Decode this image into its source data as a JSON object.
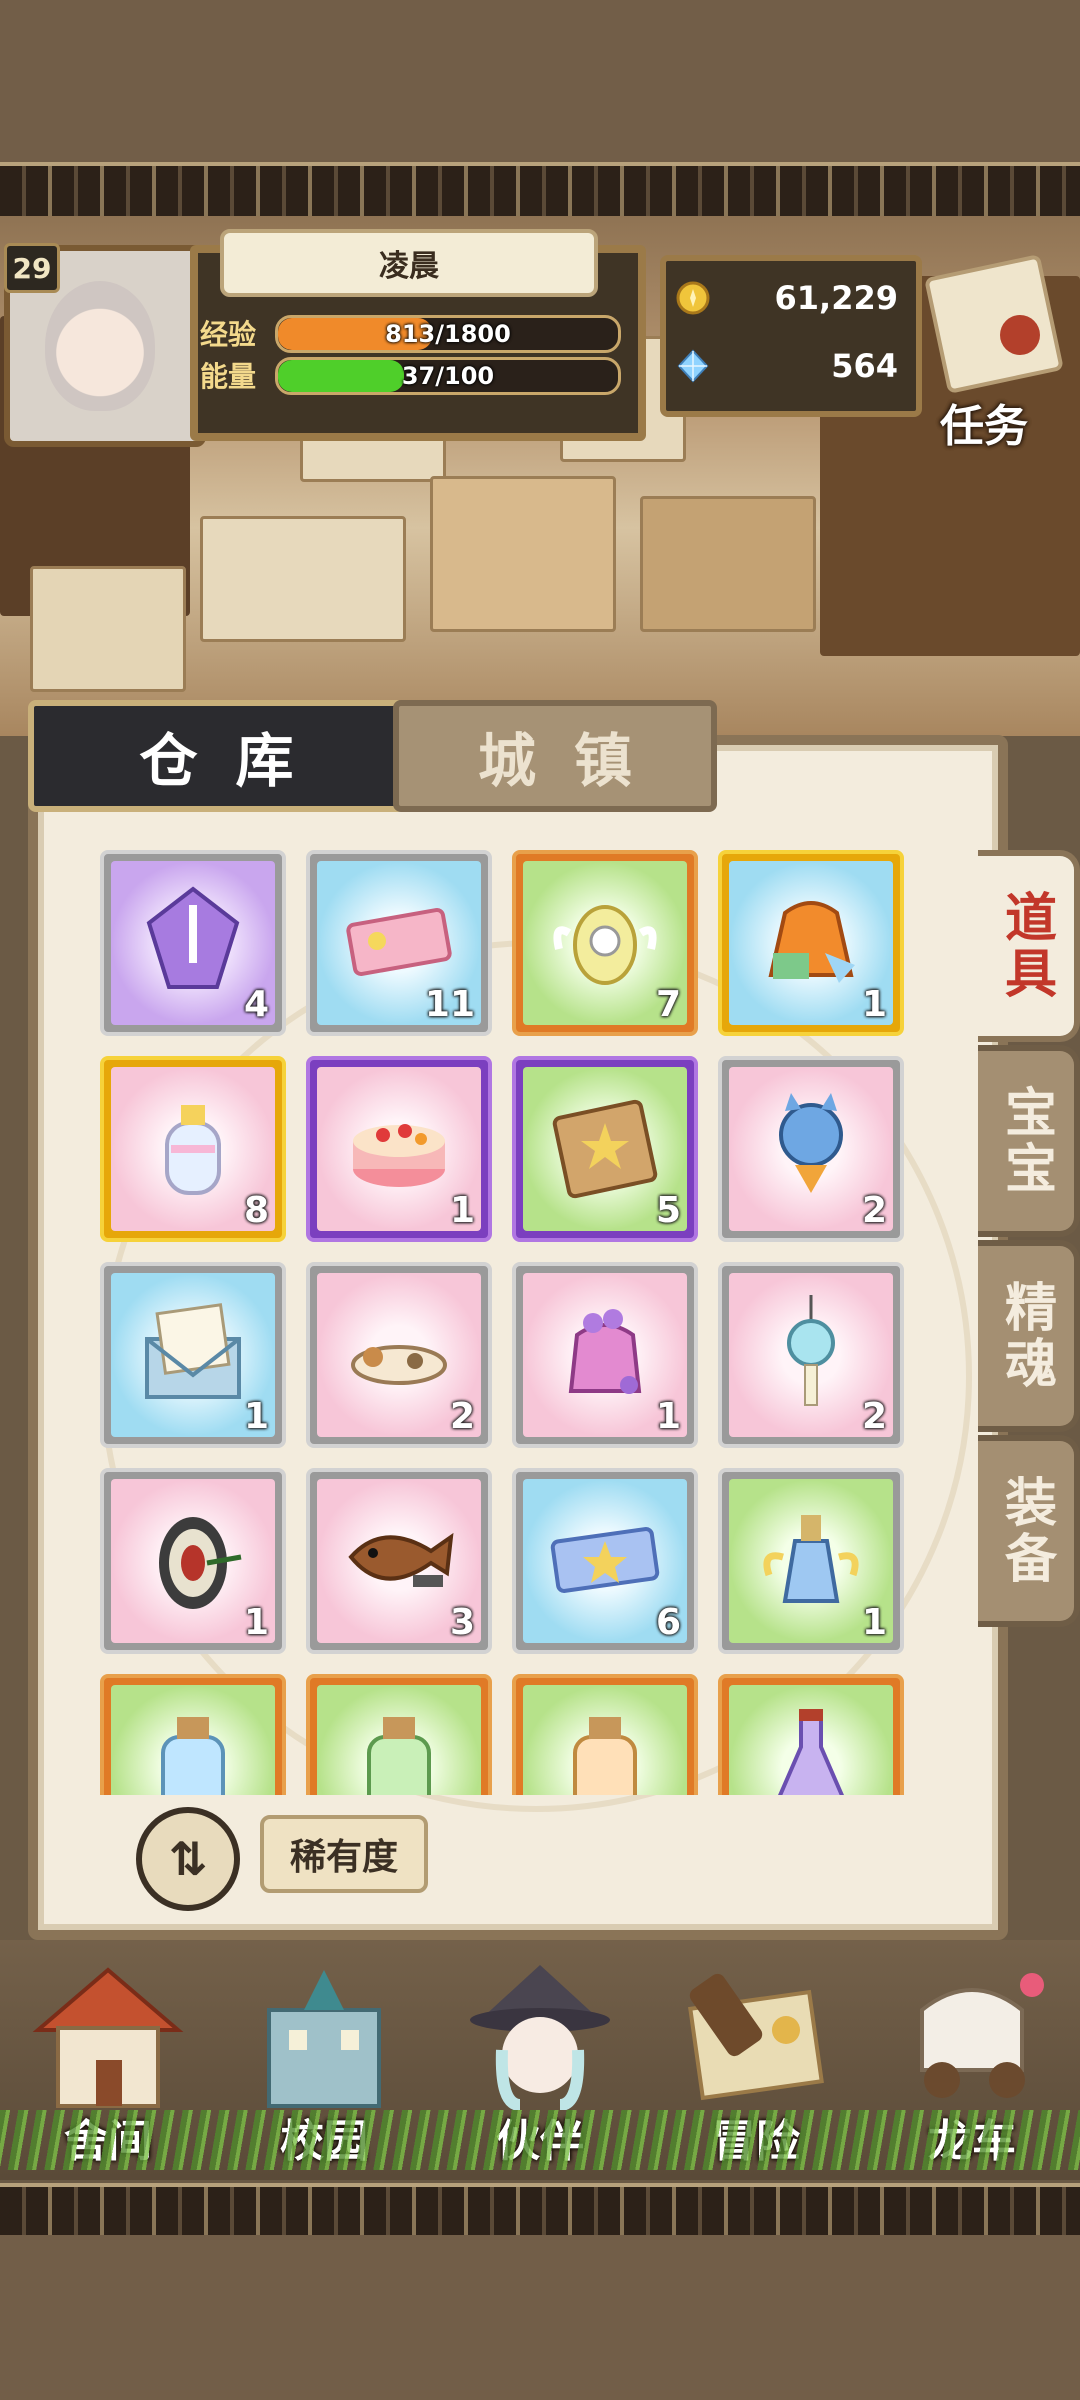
{
  "player": {
    "level": "29",
    "name": "凌晨",
    "exp_label": "经验",
    "exp_text": "813/1800",
    "exp_fraction": 0.452,
    "energy_label": "能量",
    "energy_text": "37/100",
    "energy_fraction": 0.37
  },
  "currency": {
    "gold": "61,229",
    "gems": "564"
  },
  "task_label": "任务",
  "tabs": {
    "main": "仓库",
    "secondary": "城镇"
  },
  "side_tabs": [
    "道具",
    "宝宝",
    "精魂",
    "装备"
  ],
  "items": [
    {
      "icon": "purple-crystal-icon",
      "count": "4",
      "bg": "purple",
      "frame": "white"
    },
    {
      "icon": "pink-ticket-icon",
      "count": "11",
      "bg": "blue",
      "frame": "white"
    },
    {
      "icon": "angel-clock-egg-icon",
      "count": "7",
      "bg": "green",
      "frame": "orange"
    },
    {
      "icon": "lucky-bag-icon",
      "count": "1",
      "bg": "blue",
      "frame": "gold"
    },
    {
      "icon": "perfume-bottle-icon",
      "count": "8",
      "bg": "pink",
      "frame": "gold"
    },
    {
      "icon": "fruit-cake-icon",
      "count": "1",
      "bg": "pink",
      "frame": "purple"
    },
    {
      "icon": "star-book-icon",
      "count": "5",
      "bg": "green",
      "frame": "purple"
    },
    {
      "icon": "cat-plush-icon",
      "count": "2",
      "bg": "pink",
      "frame": "white"
    },
    {
      "icon": "letter-envelope-icon",
      "count": "1",
      "bg": "blue",
      "frame": "white"
    },
    {
      "icon": "sleeping-cat-icon",
      "count": "2",
      "bg": "pink",
      "frame": "white"
    },
    {
      "icon": "flower-pouch-icon",
      "count": "1",
      "bg": "pink",
      "frame": "white"
    },
    {
      "icon": "wind-chime-icon",
      "count": "2",
      "bg": "pink",
      "frame": "white"
    },
    {
      "icon": "dartboard-icon",
      "count": "1",
      "bg": "pink",
      "frame": "white"
    },
    {
      "icon": "fish-plate-icon",
      "count": "3",
      "bg": "pink",
      "frame": "white"
    },
    {
      "icon": "blue-star-ticket-icon",
      "count": "6",
      "bg": "blue",
      "frame": "white"
    },
    {
      "icon": "winged-potion-icon",
      "count": "1",
      "bg": "green",
      "frame": "white"
    },
    {
      "icon": "blue-potion-jar-icon",
      "count": "",
      "bg": "green",
      "frame": "orange"
    },
    {
      "icon": "green-potion-jar-icon",
      "count": "",
      "bg": "green",
      "frame": "orange"
    },
    {
      "icon": "orange-potion-jar-icon",
      "count": "",
      "bg": "green",
      "frame": "orange"
    },
    {
      "icon": "purple-potion-flask-icon",
      "count": "",
      "bg": "green",
      "frame": "orange"
    }
  ],
  "sort_button_glyph": "⇅",
  "rarity_label": "稀有度",
  "nav": [
    {
      "label": "舍间",
      "icon": "house-icon"
    },
    {
      "label": "校园",
      "icon": "school-icon"
    },
    {
      "label": "伙伴",
      "icon": "witch-companion-icon"
    },
    {
      "label": "冒险",
      "icon": "treasure-map-icon"
    },
    {
      "label": "龙车",
      "icon": "dragon-carriage-icon"
    }
  ],
  "colors": {
    "exp_bar": "#f08a2a",
    "energy_bar": "#4fcf2a",
    "active_side_tab_text": "#c2372a"
  }
}
